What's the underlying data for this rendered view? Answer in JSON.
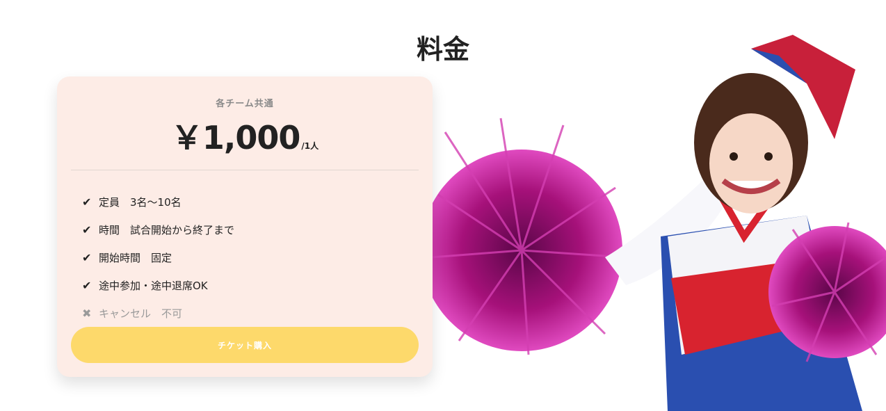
{
  "title": "料金",
  "card": {
    "subtitle": "各チーム共通",
    "price": "￥1,000",
    "unit": "/1人",
    "features": [
      {
        "icon": "check-icon",
        "mark": "✔",
        "text": "定員　3名〜10名"
      },
      {
        "icon": "check-icon",
        "mark": "✔",
        "text": "時間　試合開始から終了まで"
      },
      {
        "icon": "check-icon",
        "mark": "✔",
        "text": "開始時間　固定"
      },
      {
        "icon": "check-icon",
        "mark": "✔",
        "text": "途中参加・途中退席OK"
      },
      {
        "icon": "cross-icon",
        "mark": "✖",
        "text": "キャンセル　不可"
      }
    ],
    "button_label": "チケット購入"
  },
  "colors": {
    "card_background": "#fdece6",
    "button": "#fdd96b",
    "pompom": "#b0127f",
    "uniform_red": "#d8232f",
    "uniform_blue": "#2a4fb0"
  }
}
